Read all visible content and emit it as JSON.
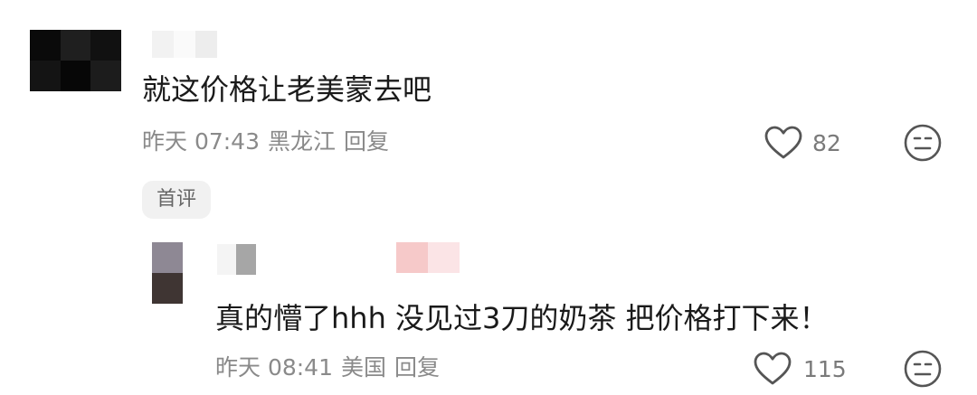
{
  "main_comment": {
    "avatar_colors": [
      "#0a0a0a",
      "#1f1f1f",
      "#111111",
      "#141414",
      "#070707",
      "#1c1c1c"
    ],
    "username_colors": [
      "#f2f2f2",
      "#fafafa",
      "#ededed"
    ],
    "text": "就这价格让老美蒙去吧",
    "time": "昨天 07:43",
    "location": "黑龙江",
    "reply_label": "回复",
    "like_count": "82",
    "badge": "首评"
  },
  "reply_comment": {
    "avatar_colors": [
      "#8e8894",
      "#3f3533"
    ],
    "username_colors": [
      "#f4f4f4",
      "#a6a6a6",
      "#ffffff"
    ],
    "tag_colors": [
      "#f6c9c9",
      "#fbe4e6"
    ],
    "text": "真的懵了hhh 没见过3刀的奶茶 把价格打下来！",
    "time": "昨天 08:41",
    "location": "美国",
    "reply_label": "回复",
    "like_count": "115"
  },
  "icons": {
    "like": "heart-outline-icon",
    "dislike": "neutral-face-icon"
  }
}
